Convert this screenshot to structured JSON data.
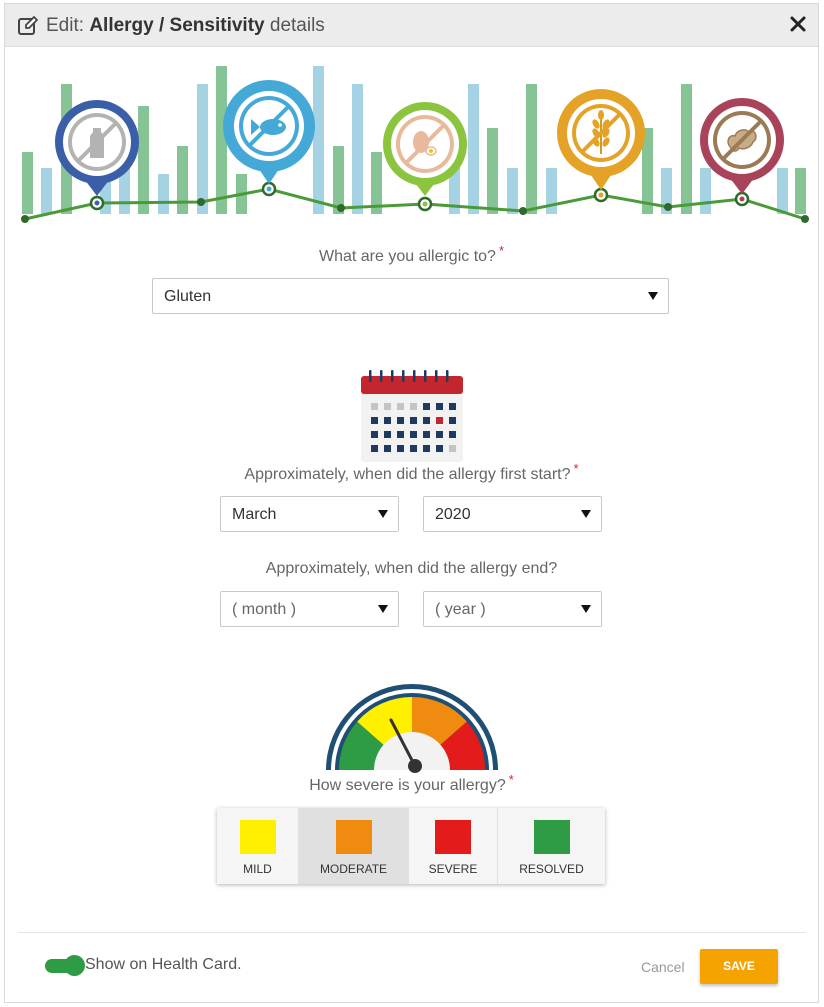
{
  "dialog": {
    "title_prefix": "Edit: ",
    "title_bold": "Allergy / Sensitivity",
    "title_suffix": " details"
  },
  "icons": {
    "edit": "edit-icon",
    "close": "close-icon",
    "categories": [
      "no-milk-icon",
      "no-fish-icon",
      "no-egg-icon",
      "no-gluten-icon",
      "no-peanut-icon"
    ]
  },
  "allergen": {
    "question": "What are you allergic to?",
    "required_mark": "*",
    "value": "Gluten"
  },
  "start": {
    "question": "Approximately, when did the allergy first start?",
    "required_mark": "*",
    "month": "March",
    "year": "2020"
  },
  "end": {
    "question": "Approximately, when did the allergy end?",
    "month_placeholder": "( month )",
    "year_placeholder": "( year )"
  },
  "severity": {
    "question": "How severe is your allergy?",
    "required_mark": "*",
    "selected": "MODERATE",
    "options": [
      {
        "label": "MILD",
        "color": "#fff000"
      },
      {
        "label": "MODERATE",
        "color": "#ef8c0f"
      },
      {
        "label": "SEVERE",
        "color": "#e31b1b"
      },
      {
        "label": "RESOLVED",
        "color": "#2e9b45"
      }
    ]
  },
  "footer": {
    "show_on_card_label": "Show on Health Card.",
    "show_on_card_enabled": true,
    "cancel_label": "Cancel",
    "save_label": "SAVE"
  },
  "colors": {
    "accent": "#f5a300",
    "toggle_on": "#2e9b45",
    "required": "#d9232d"
  }
}
